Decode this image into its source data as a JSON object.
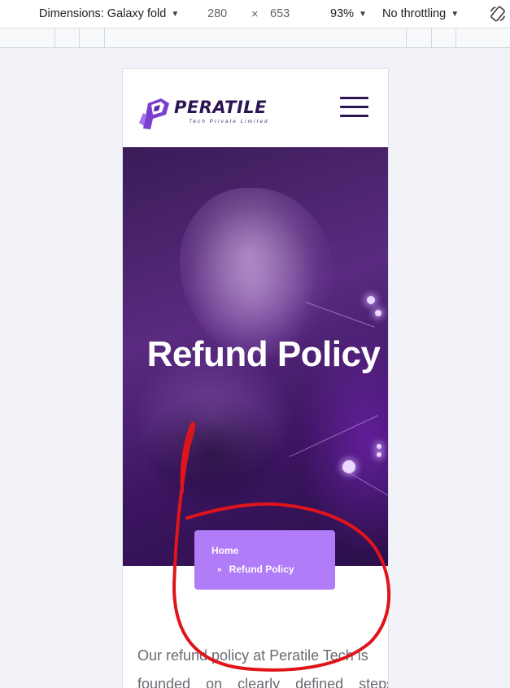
{
  "devtools": {
    "dimensions_label": "Dimensions: Galaxy fold",
    "width": "280",
    "times": "×",
    "height": "653",
    "zoom": "93%",
    "throttling": "No throttling",
    "caret": "▼",
    "rotate_icon": "rotate-icon"
  },
  "site": {
    "logo_name": "PERATILE",
    "logo_tagline": "Tech Private Limited",
    "menu_icon": "hamburger-icon"
  },
  "hero": {
    "title": "Refund Policy"
  },
  "breadcrumb": {
    "home": "Home",
    "separator": "»",
    "current": "Refund Policy"
  },
  "content": {
    "line1": "Our refund policy at Peratile Tech is",
    "line2": "founded on clearly defined steps"
  },
  "colors": {
    "brand_dark": "#2b1552",
    "breadcrumb_bg": "#b07cf8",
    "annotation": "#e0141b"
  }
}
